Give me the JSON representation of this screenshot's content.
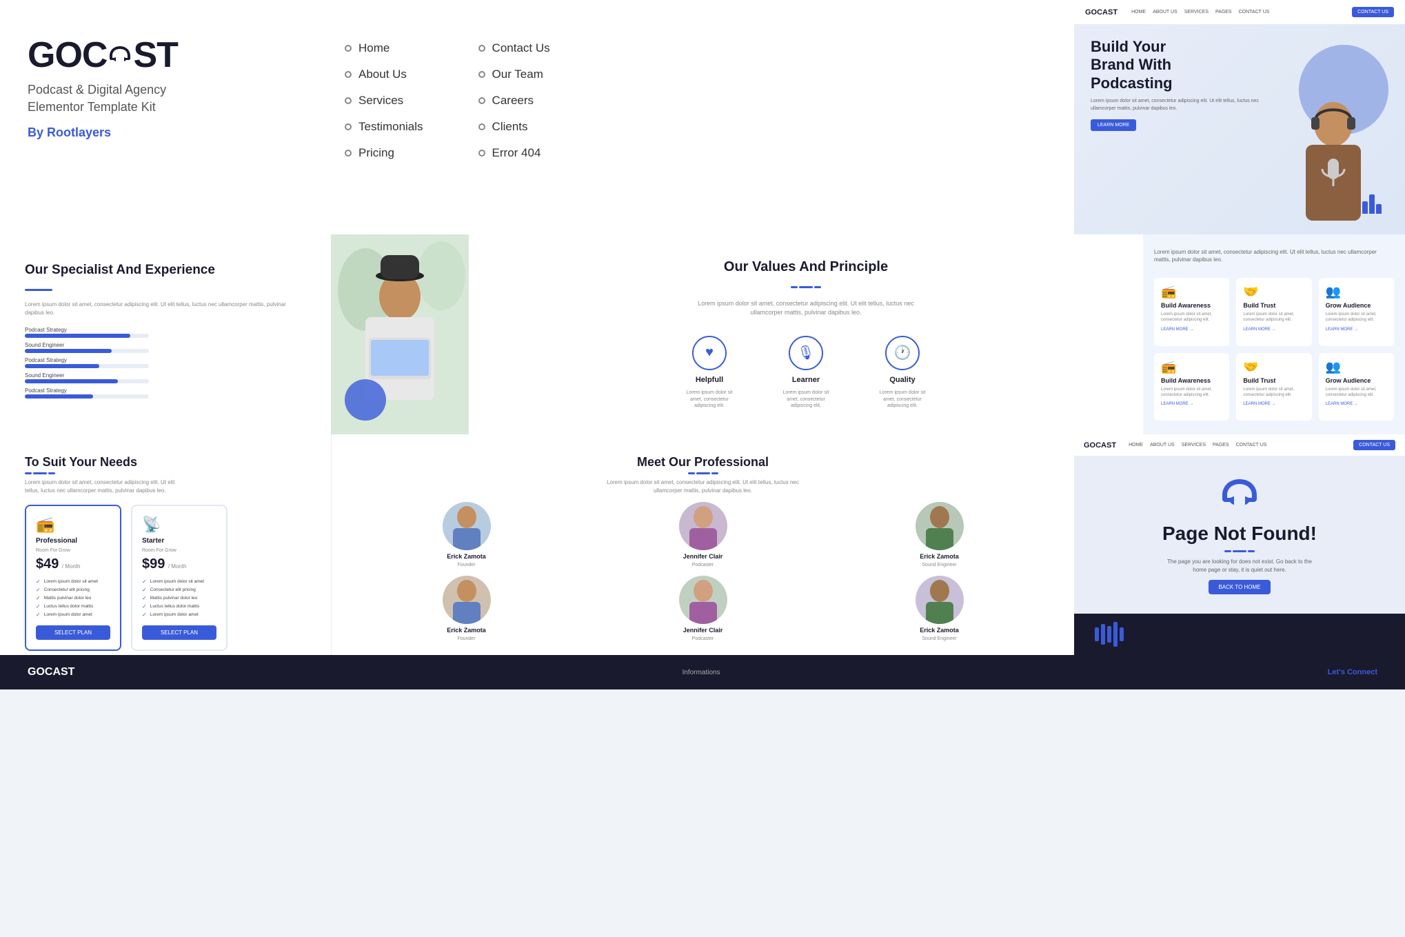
{
  "brand": {
    "name_part1": "GOC",
    "name_part2": "ST",
    "tagline_line1": "Podcast & Digital Agency",
    "tagline_line2": "Elementor Template Kit",
    "by": "By Rootlayers"
  },
  "nav": {
    "col1": [
      {
        "label": "Home"
      },
      {
        "label": "About Us"
      },
      {
        "label": "Services"
      },
      {
        "label": "Testimonials"
      },
      {
        "label": "Pricing"
      }
    ],
    "col2": [
      {
        "label": "Contact Us"
      },
      {
        "label": "Our Team"
      },
      {
        "label": "Careers"
      },
      {
        "label": "Clients"
      },
      {
        "label": "Error 404"
      }
    ]
  },
  "hero_preview": {
    "nav_logo": "GOCAST",
    "nav_links": [
      "HOME",
      "ABOUT US",
      "SERVICES",
      "PAGES",
      "CONTACT US"
    ],
    "contact_btn": "CONTACT US",
    "title_line1": "Build Your",
    "title_line2": "Brand With",
    "title_line3": "Podcasting",
    "description": "Lorem ipsum dolor sit amet, consectetur adipiscing elit. Ut elit tellus, luctus nec ullamcorper mattis, pulvinar dapibus leo.",
    "learn_btn": "LEARN MORE"
  },
  "specialist": {
    "title": "Our Specialist And Experience",
    "description": "Lorem ipsum dolor sit amet, consectetur adipiscing elit. Ut elit tellus, luctus nec ullamcorper mattis, pulvinar dapibus leo.",
    "skills": [
      {
        "label": "Podcast Strategy",
        "percent": 85
      },
      {
        "label": "Sound Engineer",
        "percent": 70
      },
      {
        "label": "Podcast Strategy",
        "percent": 60
      },
      {
        "label": "Sound Engineer",
        "percent": 75
      },
      {
        "label": "Podcast Strategy",
        "percent": 55
      }
    ]
  },
  "values": {
    "title": "Our Values And Principle",
    "description": "Lorem ipsum dolor sit amet, consectetur adipiscing elit. Ut elit tellus, luctus nec ullamcorper mattis, pulvinar dapibus leo.",
    "items": [
      {
        "icon": "♥",
        "label": "Helpfull",
        "desc": "Lorem ipsum dolor sit amet, consectetur adipiscing elit."
      },
      {
        "icon": "🎙",
        "label": "Learner",
        "desc": "Lorem ipsum dolor sit amet, consectetur adipiscing elit."
      },
      {
        "icon": "🕐",
        "label": "Quality",
        "desc": "Lorem ipsum dolor sit amet, consectetur adipiscing elit."
      }
    ]
  },
  "services": {
    "header_text": "Lorem ipsum dolor sit amet, consectetur adipiscing elit. Ut elit tellus, luctus nec ullamcorper mattis, pulvinar dapibus leo.",
    "cards": [
      {
        "icon": "📻",
        "name": "Build Awareness",
        "desc": "Lorem ipsum dolor sit amet, consectetur adipiscing elit.",
        "link": "LEARN MORE →"
      },
      {
        "icon": "🤝",
        "name": "Build Trust",
        "desc": "Lorem ipsum dolor sit amet, consectetur adipiscing elit.",
        "link": "LEARN MORE →"
      },
      {
        "icon": "👥",
        "name": "Grow Audience",
        "desc": "Lorem ipsum dolor sit amet, consectetur adipiscing elit.",
        "link": "LEARN MORE →"
      },
      {
        "icon": "📻",
        "name": "Build Awareness",
        "desc": "Lorem ipsum dolor sit amet, consectetur adipiscing elit.",
        "link": "LEARN MORE →"
      },
      {
        "icon": "🤝",
        "name": "Build Trust",
        "desc": "Lorem ipsum dolor sit amet, consectetur adipiscing elit.",
        "link": "LEARN MORE →"
      },
      {
        "icon": "👥",
        "name": "Grow Audience",
        "desc": "Lorem ipsum dolor sit amet, consectetur adipiscing elit.",
        "link": "LEARN MORE →"
      }
    ]
  },
  "pricing": {
    "title": "To Suit Your Needs",
    "description": "Lorem ipsum dolor sit amet, consectetur adipiscing elit. Ut elit tellus, luctus nec ullamcorper mattis, pulvinar dapibus leo.",
    "plans": [
      {
        "name": "Professional",
        "room": "Room For Grow",
        "price": "$49",
        "period": "/ Month",
        "featured": true,
        "features": [
          "Lorem ipsum dolor sit amet",
          "Consectetur elit pricing",
          "Mattis pulvinar dolor leo",
          "Luctus tellus dolor mattis",
          "Lorem ipsum dolor amet"
        ],
        "btn": "SELECT PLAN"
      },
      {
        "name": "Starter",
        "room": "Room For Grow",
        "price": "$99",
        "period": "/ Month",
        "featured": false,
        "features": [
          "Lorem ipsum dolor sit amet",
          "Consectetur elit pricing",
          "Mattis pulvinar dolor leo",
          "Luctus tellus dolor mattis",
          "Lorem ipsum dolor amet"
        ],
        "btn": "SELECT PLAN"
      }
    ]
  },
  "team": {
    "title": "Meet Our Professional",
    "description": "Lorem ipsum dolor sit amet, consectetur adipiscing elit. Ut elit tellus, luctus nec ullamcorper mattis, pulvinar dapibus leo.",
    "members": [
      {
        "name": "Erick Zamota",
        "role": "Founder",
        "avatar_color": "#b8cce0"
      },
      {
        "name": "Jennifer Clair",
        "role": "Podcaster",
        "avatar_color": "#c8b8d0"
      },
      {
        "name": "Erick Zamota",
        "role": "Sound Engineer",
        "avatar_color": "#b8c8b8"
      },
      {
        "name": "Erick Zamota",
        "role": "Founder",
        "avatar_color": "#d0c0b0"
      },
      {
        "name": "Jennifer Clair",
        "role": "Podcaster",
        "avatar_color": "#c0d0c0"
      },
      {
        "name": "Erick Zamota",
        "role": "Sound Engineer",
        "avatar_color": "#c8c0d8"
      }
    ]
  },
  "page_404": {
    "nav_logo": "GOCAST",
    "nav_links": [
      "HOME",
      "ABOUT US",
      "SERVICES",
      "PAGES",
      "CONTACT US"
    ],
    "contact_btn": "CONTACT US",
    "title": "Page Not Found!",
    "description": "The page you are looking for does not exist. Go back to the home page or stay, it is quiet out here.",
    "btn": "BACK TO HOME"
  },
  "footer_preview": {
    "logo": "GOCAST",
    "informations": "Informations",
    "lets_connect": "Let's Connect"
  },
  "accent_color": "#3a5bd9",
  "dark_color": "#1a1a2e"
}
